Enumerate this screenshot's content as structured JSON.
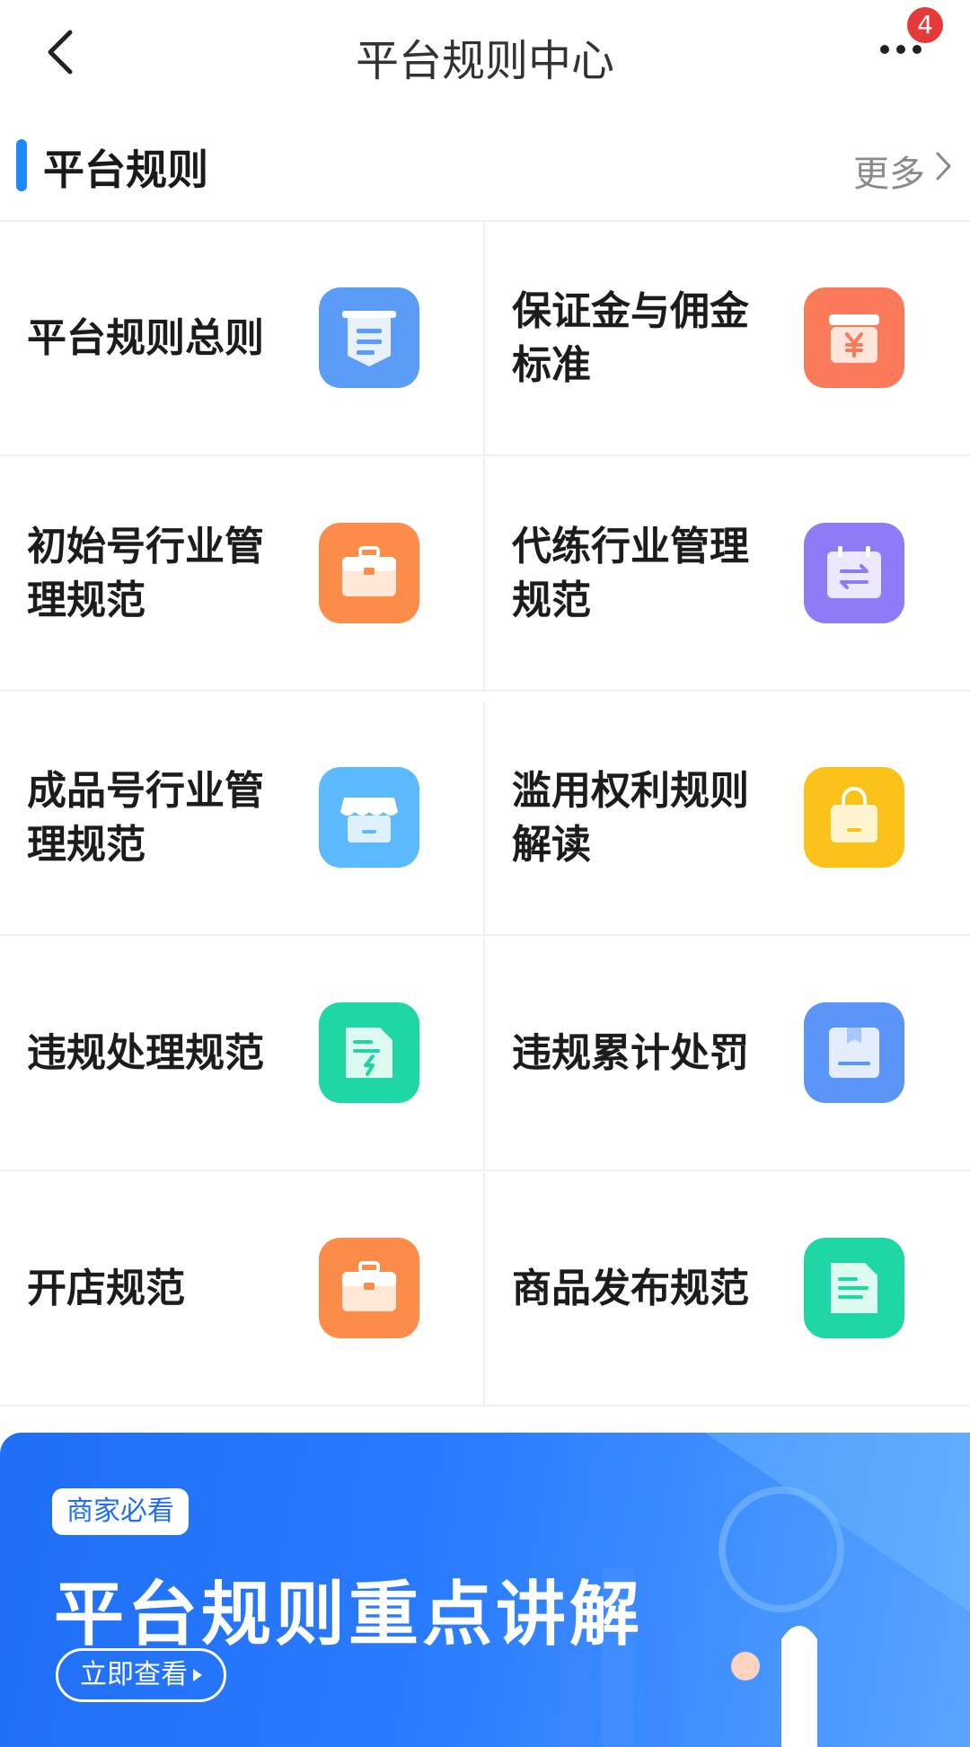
{
  "header": {
    "title": "平台规则中心",
    "badge_count": "4"
  },
  "section": {
    "title": "平台规则",
    "more_label": "更多"
  },
  "cards": [
    {
      "label": "平台规则总则",
      "icon": "document-icon",
      "color": "#5b9cf8"
    },
    {
      "label": "保证金与佣金标准",
      "icon": "yuan-box-icon",
      "color": "#fb7a5a"
    },
    {
      "label": "初始号行业管理规范",
      "icon": "briefcase-icon",
      "color": "#fb8c4a"
    },
    {
      "label": "代练行业管理规范",
      "icon": "exchange-calendar-icon",
      "color": "#8f7bf5"
    },
    {
      "label": "成品号行业管理规范",
      "icon": "store-icon",
      "color": "#5cb9fb"
    },
    {
      "label": "滥用权利规则解读",
      "icon": "shopping-bag-icon",
      "color": "#fbc21a"
    },
    {
      "label": "违规处理规范",
      "icon": "file-lightning-icon",
      "color": "#1fd6a5"
    },
    {
      "label": "违规累计处罚",
      "icon": "package-box-icon",
      "color": "#5b95f8"
    },
    {
      "label": "开店规范",
      "icon": "briefcase-icon",
      "color": "#fb8c4a"
    },
    {
      "label": "商品发布规范",
      "icon": "file-lines-icon",
      "color": "#1fd6a5"
    }
  ],
  "banner": {
    "tag": "商家必看",
    "title": "平台规则重点讲解",
    "cta": "立即查看"
  }
}
